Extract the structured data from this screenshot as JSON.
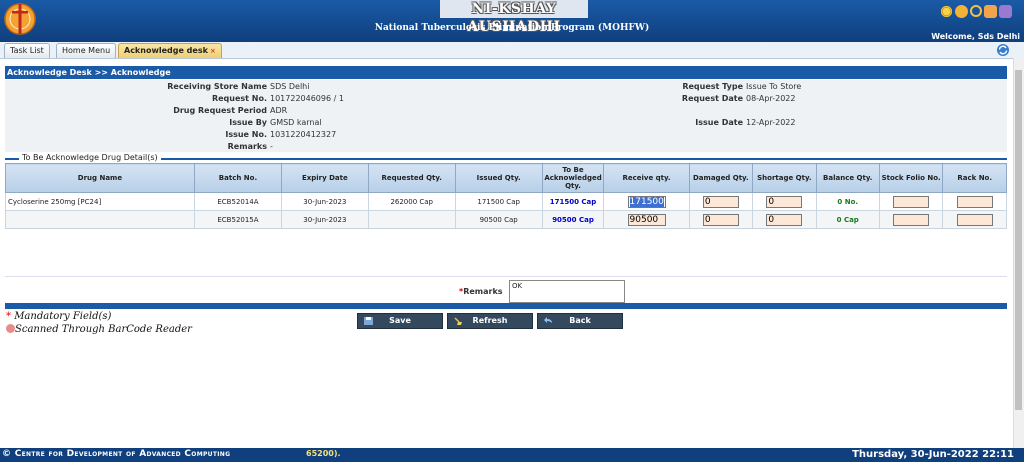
{
  "header": {
    "app_title": "NI-KSHAY AUSHADHI",
    "program_title": "National Tuberculosis Elimination Program (MOHFW)",
    "welcome": "Welcome, Sds Delhi"
  },
  "tabs": [
    {
      "label": "Task List"
    },
    {
      "label": "Home Menu"
    },
    {
      "label": "Acknowledge desk",
      "close": "×"
    }
  ],
  "breadcrumb": "Acknowledge Desk >> Acknowledge",
  "info": {
    "receiving_store_label": "Receiving Store Name",
    "receiving_store_value": "SDS Delhi",
    "request_no_label": "Request No.",
    "request_no_value": "101722046096 / 1",
    "drug_request_period_label": "Drug Request Period",
    "drug_request_period_value": "ADR",
    "issue_by_label": "Issue By",
    "issue_by_value": "GMSD karnal",
    "issue_no_label": "Issue No.",
    "issue_no_value": "1031220412327",
    "remarks_label": "Remarks",
    "remarks_value": "-",
    "request_type_label": "Request Type",
    "request_type_value": "Issue To Store",
    "request_date_label": "Request Date",
    "request_date_value": "08-Apr-2022",
    "issue_date_label": "Issue Date",
    "issue_date_value": "12-Apr-2022"
  },
  "section_title": "To Be Acknowledge Drug Detail(s)",
  "table": {
    "headers": [
      "Drug Name",
      "Batch No.",
      "Expiry Date",
      "Requested Qty.",
      "Issued Qty.",
      "To Be Acknowledged Qty.",
      "Receive qty.",
      "Damaged Qty.",
      "Shortage Qty.",
      "Balance Qty.",
      "Stock Folio No.",
      "Rack No."
    ],
    "rows": [
      {
        "drug_name": "Cycloserine 250mg [PC24]",
        "batch_no": "ECB52014A",
        "expiry_date": "30-Jun-2023",
        "requested_qty": "262000 Cap",
        "issued_qty": "171500 Cap",
        "to_ack_qty": "171500 Cap",
        "receive_qty": "171500",
        "damaged_qty": "0",
        "shortage_qty": "0",
        "balance_qty": "0 No.",
        "stock_folio_no": "",
        "rack_no": ""
      },
      {
        "drug_name": "",
        "batch_no": "ECB52015A",
        "expiry_date": "30-Jun-2023",
        "requested_qty": "",
        "issued_qty": "90500 Cap",
        "to_ack_qty": "90500 Cap",
        "receive_qty": "90500",
        "damaged_qty": "0",
        "shortage_qty": "0",
        "balance_qty": "0 Cap",
        "stock_folio_no": "",
        "rack_no": ""
      }
    ]
  },
  "remarks": {
    "required_mark": "*",
    "label": "Remarks",
    "value": "OK"
  },
  "legend": {
    "required_mark": "*",
    "mandatory": "Mandatory Field(s)",
    "barcode": "Scanned Through BarCode Reader"
  },
  "buttons": {
    "save": "Save",
    "refresh": "Refresh",
    "back": "Back"
  },
  "status_bar": {
    "org": "© Centre for Development of Advanced Computing",
    "ticker": "65200).",
    "datetime": "Thursday, 30-Jun-2022 22:11"
  },
  "colors": {
    "header_blue": "#1a5aa6",
    "active_tab": "#efcf74",
    "button": "#34495e",
    "ack_qty": "#0000cc",
    "balance_qty": "#1c7a1c"
  },
  "icons": [
    "emblem-logo",
    "settings-icon",
    "user-icon",
    "search-icon",
    "document-icon",
    "printer-icon",
    "refresh-icon",
    "save-icon",
    "broom-icon",
    "back-arrow-icon",
    "barcode-dot-icon"
  ]
}
